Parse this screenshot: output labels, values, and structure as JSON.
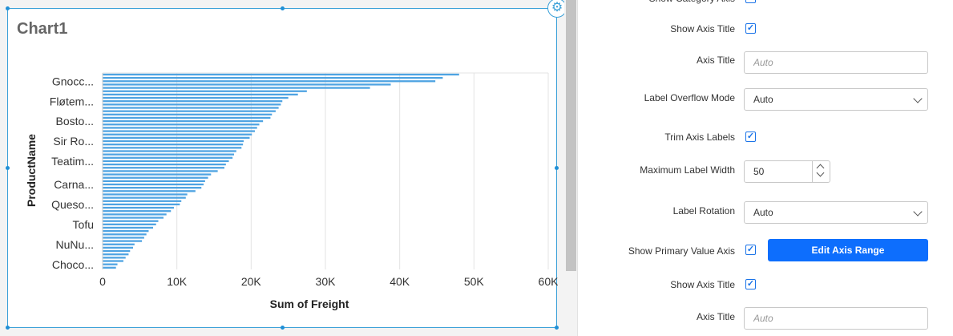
{
  "designer": {
    "widget_title": "Chart1",
    "settings_icon": "gear-icon"
  },
  "chart_data": {
    "type": "bar",
    "orientation": "horizontal",
    "title": "Chart1",
    "xlabel": "Sum of Freight",
    "ylabel": "ProductName",
    "xlim": [
      0,
      60000
    ],
    "x_tick_labels": [
      "0",
      "10K",
      "20K",
      "30K",
      "40K",
      "50K",
      "60K"
    ],
    "category_tick_labels": [
      "Gnocc...",
      "Fløtem...",
      "Bosto...",
      "Sir Ro...",
      "Teatim...",
      "Carna...",
      "Queso...",
      "Tofu",
      "NuNu...",
      "Choco..."
    ],
    "bar_color": "#4ea3e2",
    "grid": true,
    "values": [
      48000,
      45800,
      44800,
      38800,
      36000,
      27500,
      26300,
      25000,
      24200,
      24000,
      23700,
      23300,
      22800,
      22600,
      21600,
      21100,
      20800,
      20500,
      20100,
      19800,
      19000,
      18900,
      18700,
      18000,
      17700,
      17500,
      17000,
      16600,
      16400,
      15500,
      14600,
      14200,
      13800,
      13600,
      13300,
      12500,
      11400,
      11200,
      10600,
      10400,
      9600,
      9200,
      8600,
      8200,
      7500,
      7200,
      6800,
      6200,
      5900,
      5600,
      5300,
      4300,
      4100,
      3700,
      3500,
      3100,
      2800,
      2000,
      1800
    ]
  },
  "panel": {
    "rows": [
      {
        "label": "Show Category Axis",
        "checked": true
      },
      {
        "label": "Show Axis Title",
        "checked": true
      },
      {
        "label": "Axis Title",
        "value": "",
        "placeholder": "Auto"
      },
      {
        "label": "Label Overflow Mode",
        "selected": "Auto"
      },
      {
        "label": "Trim Axis Labels",
        "checked": true
      },
      {
        "label": "Maximum Label Width",
        "value": "50"
      },
      {
        "label": "Label Rotation",
        "selected": "Auto"
      },
      {
        "label": "Show Primary Value Axis",
        "checked": true,
        "button": "Edit Axis Range"
      },
      {
        "label": "Show Axis Title",
        "checked": true
      },
      {
        "label": "Axis Title",
        "value": "",
        "placeholder": "Auto"
      }
    ]
  }
}
